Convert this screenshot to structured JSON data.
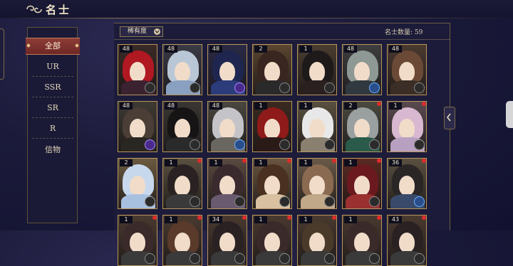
{
  "header": {
    "title": "名士"
  },
  "sidebar": {
    "items": [
      {
        "label": "全部",
        "selected": true
      },
      {
        "label": "UR",
        "selected": false
      },
      {
        "label": "SSR",
        "selected": false
      },
      {
        "label": "SR",
        "selected": false
      },
      {
        "label": "R",
        "selected": false
      },
      {
        "label": "信物",
        "selected": false
      }
    ]
  },
  "filter": {
    "sort_label": "稀有度",
    "count_label": "名士数量: 59"
  },
  "colors": {
    "accent": "#8e3c36",
    "gold": "#b8955a",
    "notification": "#e02a2a"
  },
  "cards": [
    {
      "level": "48",
      "hair": "#b01822",
      "bg": "#3a2a26",
      "body": "#3a2230",
      "badge": "gray",
      "dot": false
    },
    {
      "level": "48",
      "hair": "#b9c6d6",
      "bg": "#3a3a46",
      "body": "#8aa0c0",
      "badge": "gray",
      "dot": false
    },
    {
      "level": "48",
      "hair": "#1e2650",
      "bg": "#2a2a46",
      "body": "#2c3c7a",
      "badge": "purple",
      "dot": false
    },
    {
      "level": "2",
      "hair": "#3a2620",
      "bg": "#5a4530",
      "body": "#2a2a2a",
      "badge": "gray",
      "dot": false
    },
    {
      "level": "1",
      "hair": "#1e1a1a",
      "bg": "#4a3d30",
      "body": "#2a2020",
      "badge": "gray",
      "dot": false
    },
    {
      "level": "48",
      "hair": "#8e9894",
      "bg": "#3e3e40",
      "body": "#303840",
      "badge": "blue",
      "dot": false
    },
    {
      "level": "48",
      "hair": "#6a4a36",
      "bg": "#4a3a30",
      "body": "#3a2e26",
      "badge": "gray",
      "dot": false
    },
    {
      "level": "48",
      "hair": "#4a3e36",
      "bg": "#3e3a34",
      "body": "#2a2622",
      "badge": "purple",
      "dot": false
    },
    {
      "level": "48",
      "hair": "#161414",
      "bg": "#3a3632",
      "body": "#2a2a2a",
      "badge": "gray",
      "dot": false
    },
    {
      "level": "48",
      "hair": "#c4c4c8",
      "bg": "#4a4640",
      "body": "#6a6660",
      "badge": "blue",
      "dot": false
    },
    {
      "level": "1",
      "hair": "#8e1a1a",
      "bg": "#3a2a20",
      "body": "#2a1a18",
      "badge": "gray",
      "dot": false
    },
    {
      "level": "1",
      "hair": "#e8e8e8",
      "bg": "#5a5040",
      "body": "#8a8070",
      "badge": "gray",
      "dot": false
    },
    {
      "level": "2",
      "hair": "#9aa0a0",
      "bg": "#4a4a40",
      "body": "#2a5a4a",
      "badge": "gray",
      "dot": true
    },
    {
      "level": "1",
      "hair": "#d8b8d0",
      "bg": "#5a4a50",
      "body": "#b8a0c0",
      "badge": "gray",
      "dot": true
    },
    {
      "level": "2",
      "hair": "#c8d8ec",
      "bg": "#6a5a40",
      "body": "#a8c0e0",
      "badge": "gray",
      "dot": false
    },
    {
      "level": "1",
      "hair": "#2a2222",
      "bg": "#5a5040",
      "body": "#3a3a3a",
      "badge": "gray",
      "dot": true
    },
    {
      "level": "1",
      "hair": "#3a2a2e",
      "bg": "#5a4a40",
      "body": "#6a5a70",
      "badge": "gray",
      "dot": true
    },
    {
      "level": "1",
      "hair": "#4a3020",
      "bg": "#6a5540",
      "body": "#d8c0a0",
      "badge": "gray",
      "dot": true
    },
    {
      "level": "1",
      "hair": "#8a6a50",
      "bg": "#6a5a48",
      "body": "#c0a888",
      "badge": "gray",
      "dot": true
    },
    {
      "level": "1",
      "hair": "#6a1a1e",
      "bg": "#5a2a22",
      "body": "#9a3030",
      "badge": "gray",
      "dot": true
    },
    {
      "level": "36",
      "hair": "#2a2626",
      "bg": "#5a5040",
      "body": "#3a4a6a",
      "badge": "blue",
      "dot": true
    },
    {
      "level": "1",
      "hair": "#3a2a2a",
      "bg": "#4a3a30",
      "body": "#3a3a3a",
      "badge": "gray",
      "dot": true
    },
    {
      "level": "1",
      "hair": "#5a3a2a",
      "bg": "#4a3a30",
      "body": "#3a3a3a",
      "badge": "gray",
      "dot": true
    },
    {
      "level": "34",
      "hair": "#2a2222",
      "bg": "#4a3a30",
      "body": "#3a3a3a",
      "badge": "gray",
      "dot": true
    },
    {
      "level": "1",
      "hair": "#3a2a2a",
      "bg": "#4a3a30",
      "body": "#3a3a3a",
      "badge": "gray",
      "dot": true
    },
    {
      "level": "1",
      "hair": "#4a3a2a",
      "bg": "#4a3a30",
      "body": "#3a3a3a",
      "badge": "gray",
      "dot": true
    },
    {
      "level": "1",
      "hair": "#3a2a2a",
      "bg": "#4a3a30",
      "body": "#3a3a3a",
      "badge": "gray",
      "dot": true
    },
    {
      "level": "43",
      "hair": "#2a2222",
      "bg": "#4a3a30",
      "body": "#3a3a3a",
      "badge": "gray",
      "dot": true
    }
  ]
}
